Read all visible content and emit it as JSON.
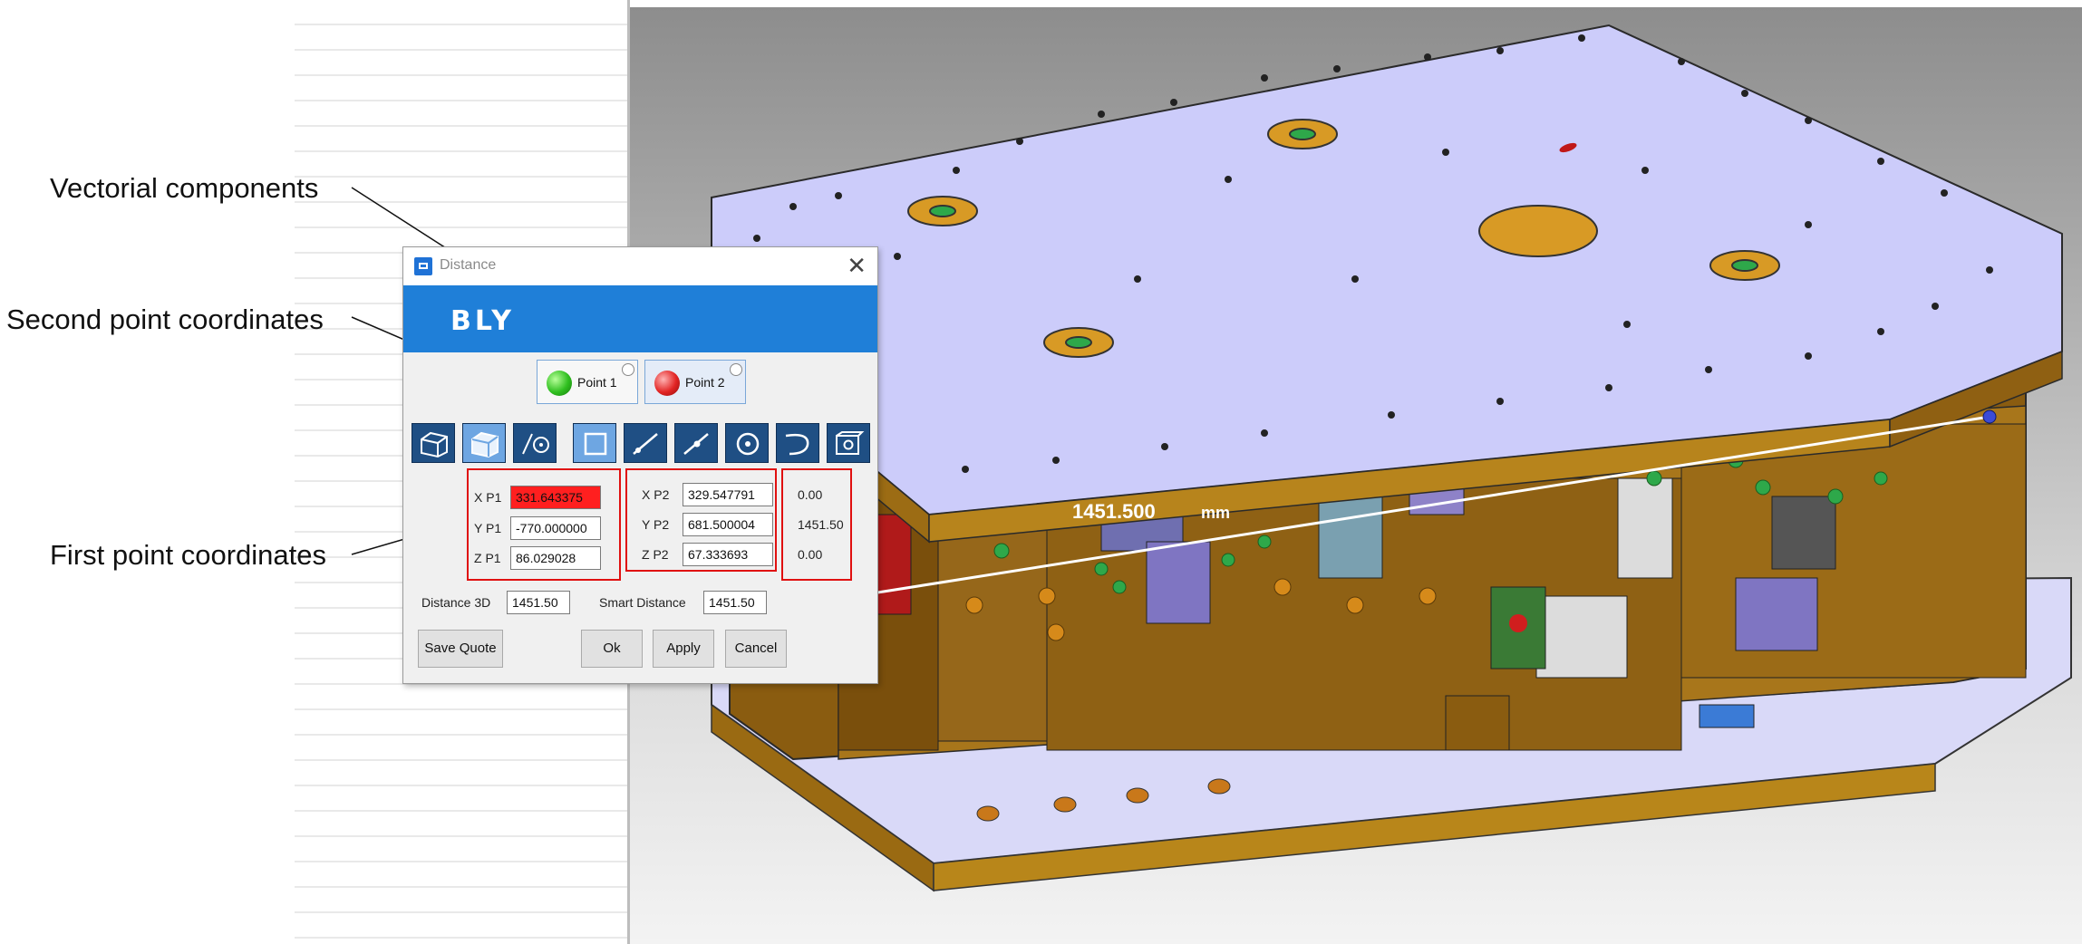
{
  "callouts": {
    "vectorial": "Vectorial components",
    "second": "Second point coordinates",
    "first": "First point coordinates"
  },
  "dialog": {
    "title": "Distance",
    "close_glyph": "✕",
    "logo": "BLY",
    "point1_label": "Point 1",
    "point2_label": "Point 2",
    "tools": [
      "bounding-box-icon",
      "box-select-icon",
      "edge-circle-icon",
      "square-icon",
      "line-point-icon",
      "line-point-alt-icon",
      "circle-center-icon",
      "arc-icon",
      "box-hole-icon"
    ],
    "p1": {
      "x_label": "X P1",
      "x": "331.643375",
      "y_label": "Y P1",
      "y": "-770.000000",
      "z_label": "Z P1",
      "z": "86.029028"
    },
    "p2": {
      "x_label": "X P2",
      "x": "329.547791",
      "y_label": "Y P2",
      "y": "681.500004",
      "z_label": "Z P2",
      "z": "67.333693"
    },
    "vector": {
      "x": "0.00",
      "y": "1451.50",
      "z": "0.00"
    },
    "distance3d_label": "Distance 3D",
    "distance3d": "1451.50",
    "smart_label": "Smart Distance",
    "smart": "1451.50",
    "save_quote": "Save Quote",
    "ok": "Ok",
    "apply": "Apply",
    "cancel": "Cancel",
    "highlight_color": "#ff1f1f",
    "accent_color": "#1f7fd8"
  },
  "viewport": {
    "measure_value": "1451.500",
    "measure_unit": "mm"
  }
}
